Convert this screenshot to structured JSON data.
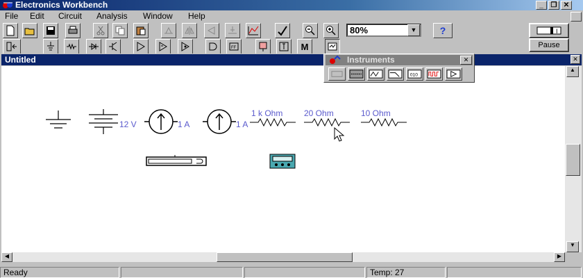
{
  "app": {
    "title": "Electronics Workbench"
  },
  "menu": [
    {
      "label": "File"
    },
    {
      "label": "Edit"
    },
    {
      "label": "Circuit"
    },
    {
      "label": "Analysis"
    },
    {
      "label": "Window"
    },
    {
      "label": "Help"
    }
  ],
  "toolbar": {
    "zoom_value": "80%",
    "pause_label": "Pause"
  },
  "document": {
    "title": "Untitled"
  },
  "instruments": {
    "title": "Instruments"
  },
  "components": {
    "battery_label": "12 V",
    "current_source1_label": "1 A",
    "current_source2_label": "1 A",
    "r1_label": "1 k Ohm",
    "r2_label": "20  Ohm",
    "r3_label": "10  Ohm"
  },
  "status": {
    "ready": "Ready",
    "temp": "Temp:  27"
  },
  "colors": {
    "title_bar": "#0a246a",
    "label_blue": "#5a5acd",
    "multimeter_teal": "#4aa8b0"
  }
}
